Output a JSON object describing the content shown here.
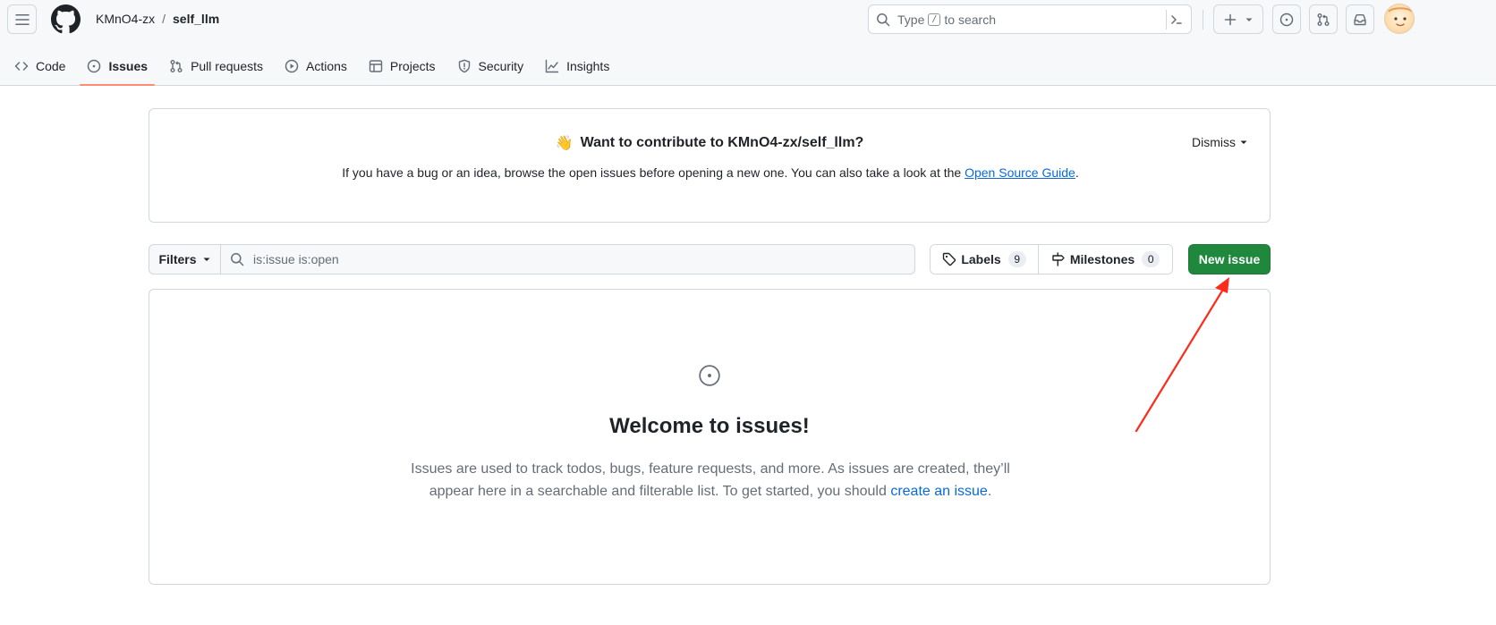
{
  "header": {
    "repo_owner": "KMnO4-zx",
    "repo_separator": "/",
    "repo_name": "self_llm",
    "search": {
      "prefix": "Type",
      "key": "/",
      "suffix": "to search"
    }
  },
  "nav": {
    "items": [
      {
        "label": "Code",
        "icon": "code-icon"
      },
      {
        "label": "Issues",
        "icon": "issue-opened-icon",
        "active": true
      },
      {
        "label": "Pull requests",
        "icon": "git-pull-request-icon"
      },
      {
        "label": "Actions",
        "icon": "play-icon"
      },
      {
        "label": "Projects",
        "icon": "table-icon"
      },
      {
        "label": "Security",
        "icon": "shield-icon"
      },
      {
        "label": "Insights",
        "icon": "graph-icon"
      }
    ]
  },
  "banner": {
    "emoji": "👋",
    "title": "Want to contribute to KMnO4-zx/self_llm?",
    "text_before": "If you have a bug or an idea, browse the open issues before opening a new one. You can also take a look at the ",
    "link": "Open Source Guide",
    "text_after": ".",
    "dismiss": "Dismiss"
  },
  "filter_bar": {
    "filters_label": "Filters",
    "query": "is:issue is:open",
    "labels_label": "Labels",
    "labels_count": "9",
    "milestones_label": "Milestones",
    "milestones_count": "0",
    "new_issue_label": "New issue"
  },
  "blankslate": {
    "title": "Welcome to issues!",
    "text_before": "Issues are used to track todos, bugs, feature requests, and more. As issues are created, they’ll appear here in a searchable and filterable list. To get started, you should ",
    "link": "create an issue",
    "text_after": "."
  },
  "colors": {
    "primary_button": "#1f883d",
    "link": "#0969da",
    "active_tab_underline": "#fd8c73",
    "annotation_arrow": "#ff2a1a"
  }
}
